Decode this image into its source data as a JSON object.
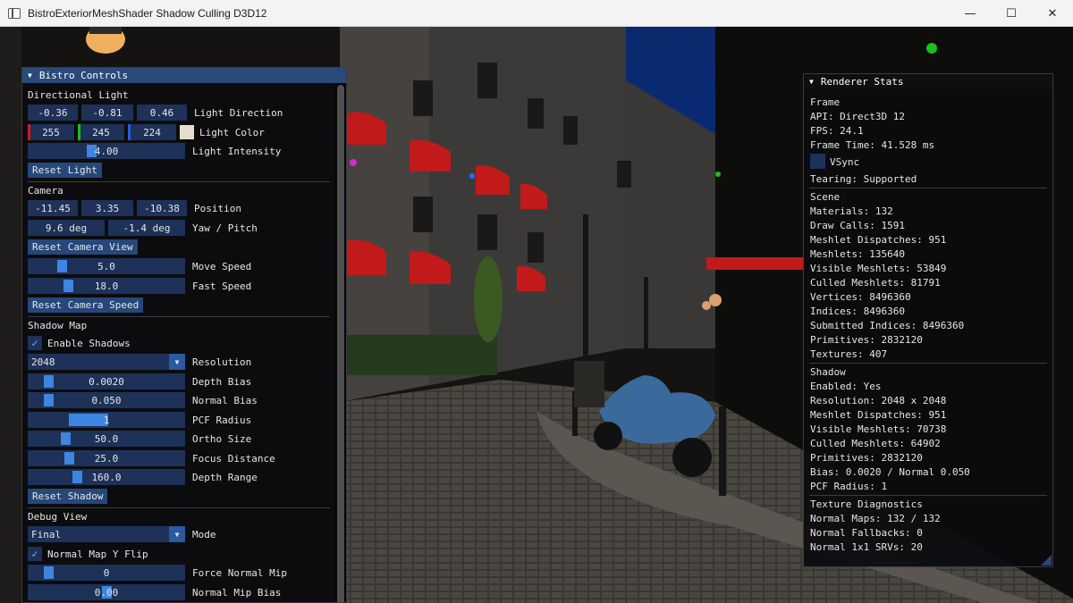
{
  "window": {
    "title": "BistroExteriorMeshShader Shadow Culling D3D12",
    "minimize_glyph": "—",
    "maximize_glyph": "☐",
    "close_glyph": "✕"
  },
  "controls": {
    "title": "Bistro Controls",
    "collapse_glyph": "▼",
    "directional_light": {
      "header": "Directional Light",
      "direction": [
        "-0.36",
        "-0.81",
        "0.46"
      ],
      "direction_label": "Light Direction",
      "color": [
        "255",
        "245",
        "224"
      ],
      "color_label": "Light Color",
      "color_swatch": "#e5dccb",
      "intensity": "4.00",
      "intensity_fraction": 0.4,
      "intensity_label": "Light Intensity",
      "reset_label": "Reset Light"
    },
    "camera": {
      "header": "Camera",
      "position": [
        "-11.45",
        "3.35",
        "-10.38"
      ],
      "position_label": "Position",
      "yaw": "9.6 deg",
      "pitch": "-1.4 deg",
      "yaw_pitch_label": "Yaw / Pitch",
      "reset_view_label": "Reset Camera View",
      "move_speed": "5.0",
      "move_speed_fraction": 0.2,
      "move_speed_label": "Move Speed",
      "fast_speed": "18.0",
      "fast_speed_fraction": 0.24,
      "fast_speed_label": "Fast Speed",
      "reset_speed_label": "Reset Camera Speed"
    },
    "shadow_map": {
      "header": "Shadow Map",
      "enable_label": "Enable Shadows",
      "enabled": true,
      "resolution_value": "2048",
      "resolution_label": "Resolution",
      "depth_bias": "0.0020",
      "depth_bias_label": "Depth Bias",
      "normal_bias": "0.050",
      "normal_bias_label": "Normal Bias",
      "pcf_radius": "1",
      "pcf_radius_label": "PCF Radius",
      "ortho_size": "50.0",
      "ortho_size_label": "Ortho Size",
      "focus_distance": "25.0",
      "focus_distance_label": "Focus Distance",
      "depth_range": "160.0",
      "depth_range_label": "Depth Range",
      "reset_label": "Reset Shadow"
    },
    "debug_view": {
      "header": "Debug View",
      "mode_value": "Final",
      "mode_label": "Mode",
      "normal_flip_label": "Normal Map Y Flip",
      "normal_flip": true,
      "force_mip": "0",
      "force_mip_label": "Force Normal Mip",
      "mip_bias": "0.00",
      "mip_bias_label": "Normal Mip Bias"
    }
  },
  "stats": {
    "title": "Renderer Stats",
    "collapse_glyph": "▼",
    "frame": {
      "header": "Frame",
      "api": "API: Direct3D 12",
      "fps": "FPS: 24.1",
      "frame_time": "Frame Time: 41.528 ms",
      "vsync_label": "VSync",
      "tearing": "Tearing: Supported"
    },
    "scene": {
      "header": "Scene",
      "lines": [
        "Materials: 132",
        "Draw Calls: 1591",
        "Meshlet Dispatches: 951",
        "Meshlets: 135640",
        "Visible Meshlets: 53849",
        "Culled Meshlets: 81791",
        "Vertices: 8496360",
        "Indices: 8496360",
        "Submitted Indices: 8496360",
        "Primitives: 2832120",
        "Textures: 407"
      ]
    },
    "shadow": {
      "header": "Shadow",
      "lines": [
        "Enabled: Yes",
        "Resolution: 2048 x 2048",
        "Meshlet Dispatches: 951",
        "Visible Meshlets: 70738",
        "Culled Meshlets: 64902",
        "Primitives: 2832120",
        "Bias: 0.0020 / Normal 0.050",
        "PCF Radius: 1"
      ]
    },
    "texture_diagnostics": {
      "header": "Texture Diagnostics",
      "lines": [
        "Normal Maps: 132 / 132",
        "Normal Fallbacks: 0",
        "Normal 1x1 SRVs: 20"
      ]
    }
  }
}
